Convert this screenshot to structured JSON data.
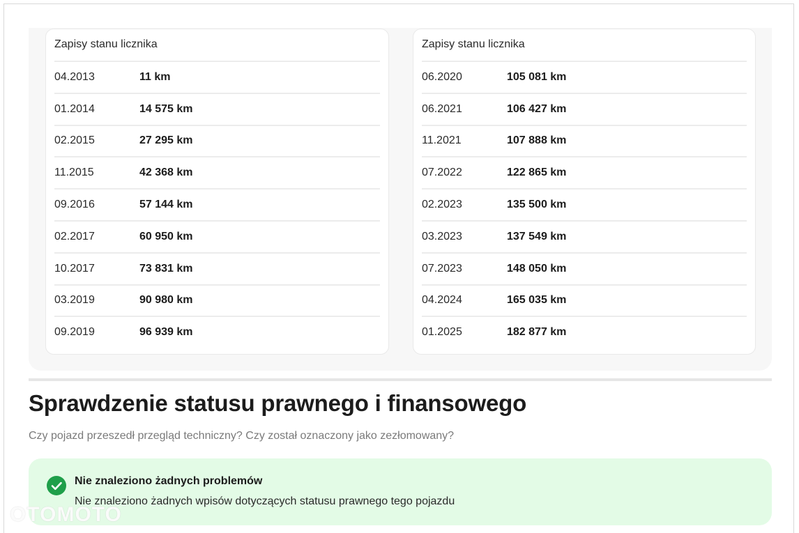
{
  "mileage_history": {
    "left_card": {
      "title": "Zapisy stanu licznika",
      "rows": [
        {
          "date": "04.2013",
          "km": "11 km"
        },
        {
          "date": "01.2014",
          "km": "14 575 km"
        },
        {
          "date": "02.2015",
          "km": "27 295 km"
        },
        {
          "date": "11.2015",
          "km": "42 368 km"
        },
        {
          "date": "09.2016",
          "km": "57 144 km"
        },
        {
          "date": "02.2017",
          "km": "60 950 km"
        },
        {
          "date": "10.2017",
          "km": "73 831 km"
        },
        {
          "date": "03.2019",
          "km": "90 980 km"
        },
        {
          "date": "09.2019",
          "km": "96 939 km"
        }
      ]
    },
    "right_card": {
      "title": "Zapisy stanu licznika",
      "rows": [
        {
          "date": "06.2020",
          "km": "105 081 km"
        },
        {
          "date": "06.2021",
          "km": "106 427 km"
        },
        {
          "date": "11.2021",
          "km": "107 888 km"
        },
        {
          "date": "07.2022",
          "km": "122 865 km"
        },
        {
          "date": "02.2023",
          "km": "135 500 km"
        },
        {
          "date": "03.2023",
          "km": "137 549 km"
        },
        {
          "date": "07.2023",
          "km": "148 050 km"
        },
        {
          "date": "04.2024",
          "km": "165 035 km"
        },
        {
          "date": "01.2025",
          "km": "182 877 km"
        }
      ]
    }
  },
  "legal_status": {
    "title": "Sprawdzenie statusu prawnego i finansowego",
    "subtitle": "Czy pojazd przeszedł przegląd techniczny? Czy został oznaczony jako zezłomowany?",
    "result": {
      "icon": "check-circle-icon",
      "color": "#1f9f4a",
      "background": "#e3fbe6",
      "title": "Nie znaleziono żadnych problemów",
      "description": "Nie znaleziono żadnych wpisów dotyczących statusu prawnego tego pojazdu"
    }
  },
  "watermark": {
    "text": "OTOMOTO"
  }
}
